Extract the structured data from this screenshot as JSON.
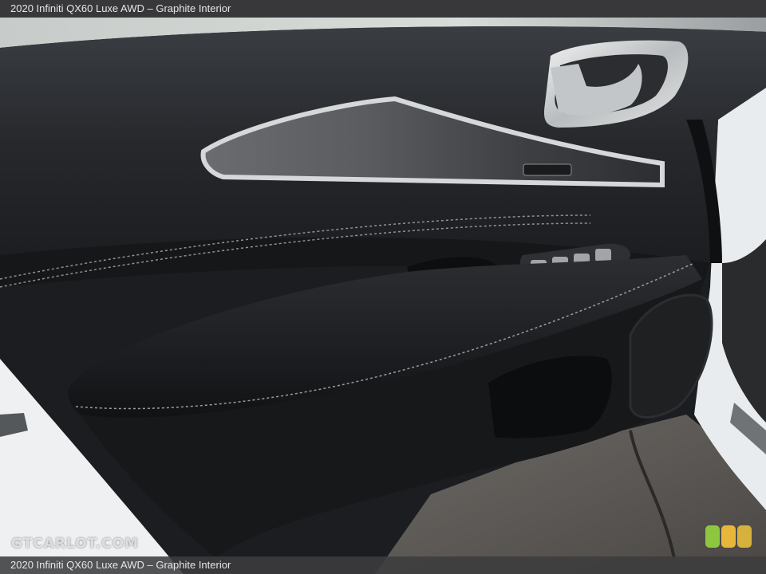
{
  "caption": {
    "top": "2020 Infiniti QX60 Luxe AWD – Graphite Interior",
    "bottom": "2020 Infiniti QX60 Luxe AWD – Graphite Interior"
  },
  "watermark": "GTCARLOT.COM",
  "badge_colors": [
    "#8dc63f",
    "#e8b73a",
    "#d6b23c"
  ]
}
